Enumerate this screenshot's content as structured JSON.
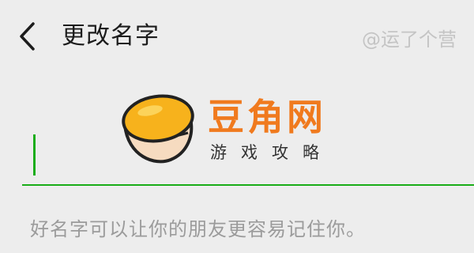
{
  "header": {
    "title": "更改名字",
    "back_icon": "chevron-left-icon"
  },
  "watermark": {
    "user_tag": "@运了个营",
    "brand_name": "豆角网",
    "brand_tagline": "游戏攻略"
  },
  "form": {
    "name_value": "",
    "hint": "好名字可以让你的朋友更容易记住你。"
  },
  "colors": {
    "background": "#ededed",
    "accent": "#1aad19",
    "brand": "#f07a1e",
    "hint_text": "#9b9b9b"
  }
}
